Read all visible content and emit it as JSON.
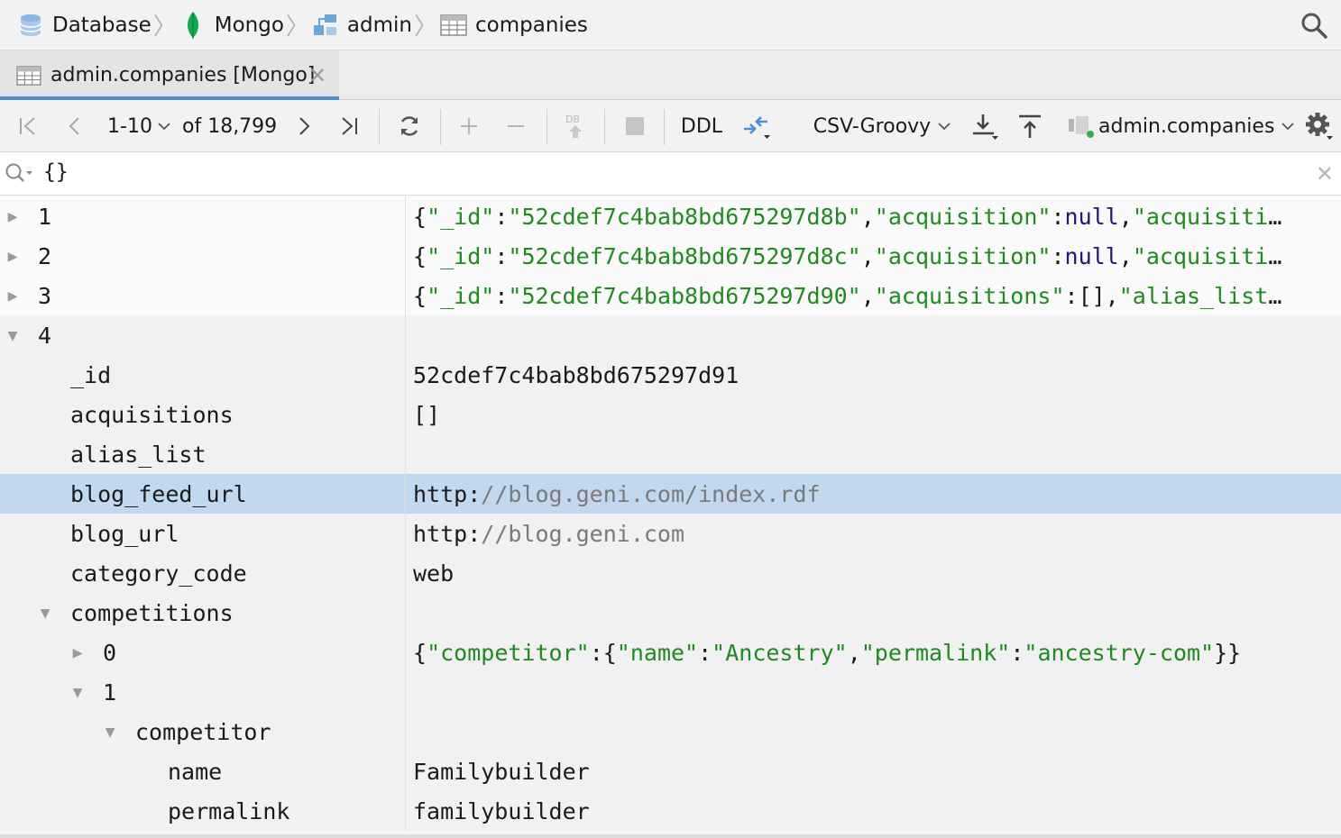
{
  "breadcrumb": {
    "items": [
      {
        "label": "Database",
        "icon": "database-icon"
      },
      {
        "label": "Mongo",
        "icon": "mongo-leaf-icon"
      },
      {
        "label": "admin",
        "icon": "schema-icon"
      },
      {
        "label": "companies",
        "icon": "table-icon"
      }
    ]
  },
  "tab": {
    "label": "admin.companies [Mongo]"
  },
  "toolbar": {
    "page_range": "1-10",
    "total": "of 18,799",
    "ddl_label": "DDL",
    "extractor": "CSV-Groovy",
    "collection": "admin.companies"
  },
  "filter": {
    "value": "{}"
  },
  "rows": [
    {
      "key": "1",
      "val": "{\"_id\":\"52cdef7c4bab8bd675297d8b\",\"acquisition\":null,\"acquisiti…"
    },
    {
      "key": "2",
      "val": "{\"_id\":\"52cdef7c4bab8bd675297d8c\",\"acquisition\":null,\"acquisiti…"
    },
    {
      "key": "3",
      "val": "{\"_id\":\"52cdef7c4bab8bd675297d90\",\"acquisitions\":[],\"alias_list…"
    },
    {
      "key": "4",
      "val": ""
    },
    {
      "key": "_id",
      "val": "52cdef7c4bab8bd675297d91"
    },
    {
      "key": "acquisitions",
      "val": "[]"
    },
    {
      "key": "alias_list",
      "val": ""
    },
    {
      "key": "blog_feed_url",
      "val_scheme": "http:",
      "val_rest": "//blog.geni.com/index.rdf"
    },
    {
      "key": "blog_url",
      "val_scheme": "http:",
      "val_rest": "//blog.geni.com"
    },
    {
      "key": "category_code",
      "val": "web"
    },
    {
      "key": "competitions",
      "val": ""
    },
    {
      "key": "0",
      "val": "{\"competitor\":{\"name\":\"Ancestry\",\"permalink\":\"ancestry-com\"}}"
    },
    {
      "key": "1",
      "val": ""
    },
    {
      "key": "competitor",
      "val": ""
    },
    {
      "key": "name",
      "val": "Familybuilder"
    },
    {
      "key": "permalink",
      "val": "familybuilder"
    }
  ],
  "colors": {
    "selected_row": "#c2d8ef",
    "tab_underline": "#4a8fd6",
    "json_string": "#1f8a1f",
    "json_keyword": "#1a1a7a"
  }
}
